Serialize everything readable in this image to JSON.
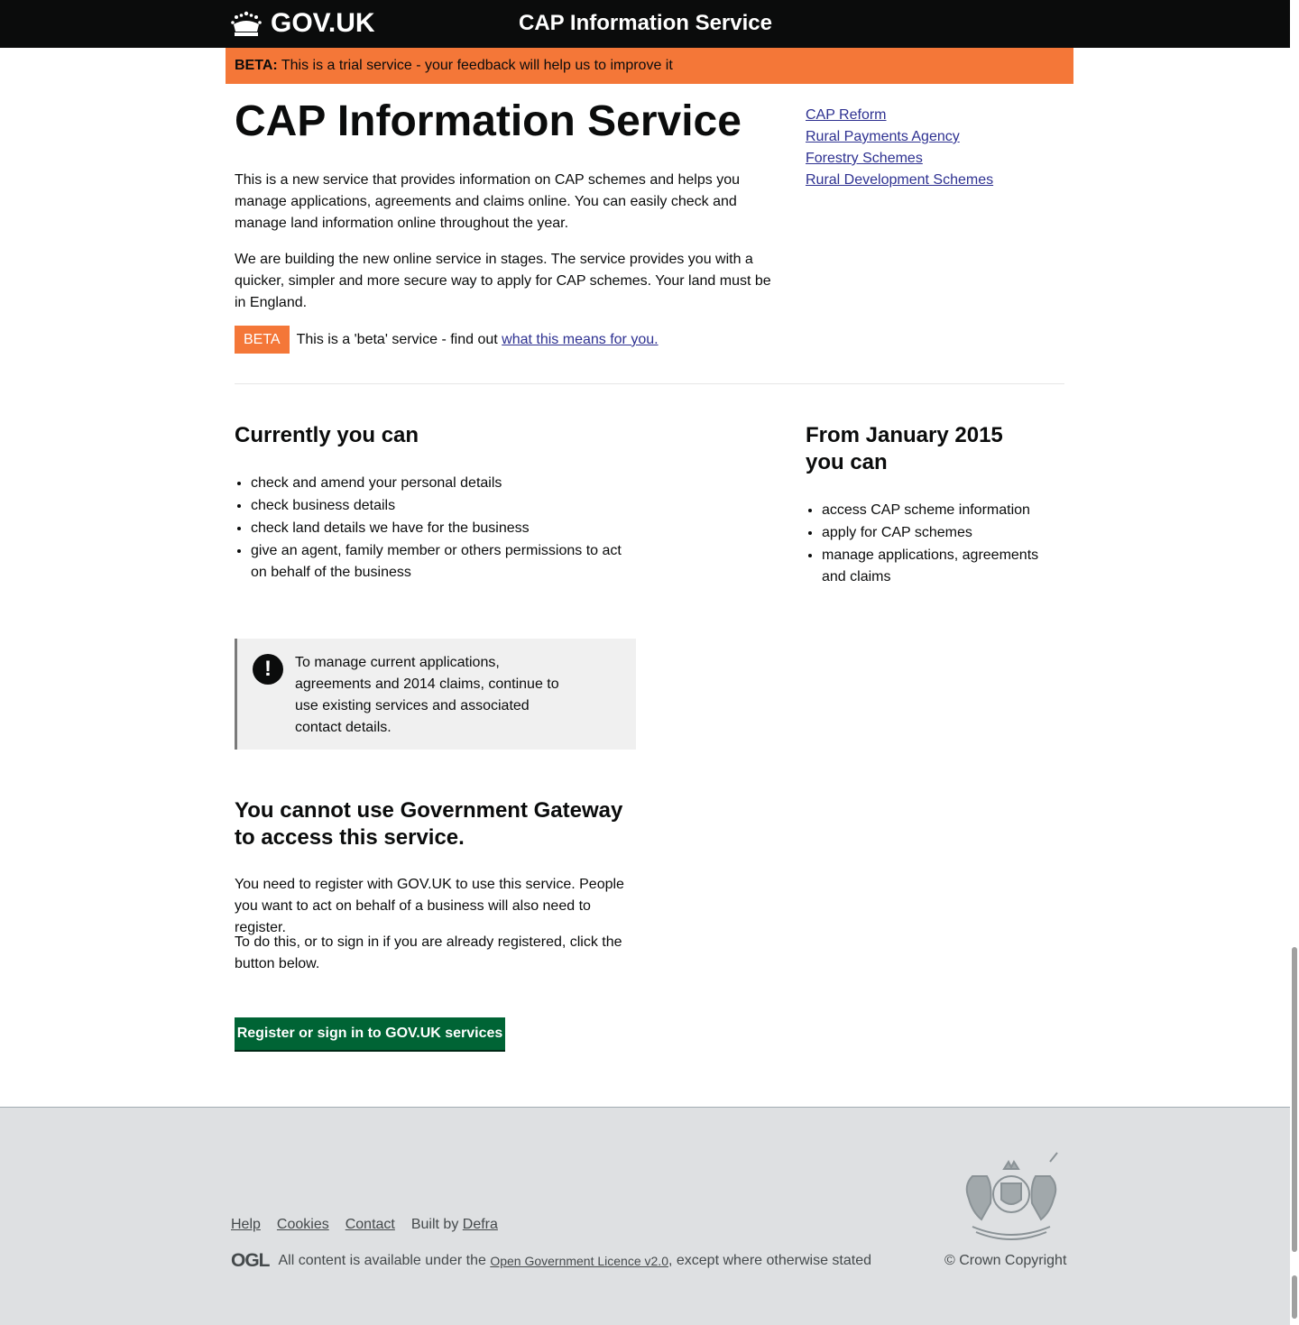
{
  "header": {
    "logo_text": "GOV.UK",
    "service_name": "CAP Information Service"
  },
  "beta_banner": {
    "label": "BETA:",
    "text": "This is a trial service - your feedback will help us to improve it"
  },
  "main": {
    "title": "CAP Information Service",
    "intro_1": "This is a new service that provides information on CAP schemes and helps you manage applications, agreements and claims online. You can easily check and manage land information online throughout the year.",
    "intro_2": "We are building the new online service in stages. The service provides you with a quicker, simpler and more secure way to apply for CAP schemes. Your land must be in England.",
    "beta_tag": "BETA",
    "beta_text": "This is a 'beta' service - find out ",
    "beta_link": "what this means for you."
  },
  "related_links": [
    "CAP Reform",
    "Rural Payments Agency",
    "Forestry Schemes",
    "Rural Development Schemes"
  ],
  "currently": {
    "heading": "Currently you can",
    "items": [
      "check and amend your personal details",
      "check business details",
      "check land details we have for the business",
      "give an agent, family member or others permissions to act on behalf of the business"
    ]
  },
  "future": {
    "heading": "From January 2015 you can",
    "items": [
      "access CAP scheme information",
      "apply for CAP schemes",
      "manage applications, agreements and claims"
    ]
  },
  "notice": {
    "icon": "!",
    "text": "To manage current applications, agreements and 2014 claims, continue to use existing services and associated contact details."
  },
  "gateway": {
    "heading": "You cannot use Government Gateway to access this service.",
    "para_1": "You need to register with GOV.UK to use this service. People you want to act on behalf of a business will also need to register.",
    "para_2": "To do this, or to sign in if you are already registered, click the button below.",
    "button": "Register or sign in to GOV.UK services"
  },
  "footer": {
    "help": "Help",
    "cookies": "Cookies",
    "contact": "Contact",
    "built_by": "Built by ",
    "defra": "Defra",
    "ogl_logo": "OGL",
    "licence_pre": "All content is available under the ",
    "licence_link": "Open Government Licence v2.0",
    "licence_post": ", except where otherwise stated",
    "copyright": "© Crown Copyright"
  },
  "colors": {
    "header_bg": "#0b0c0c",
    "beta_orange": "#f47738",
    "link": "#2e3191",
    "button_green": "#006435",
    "footer_bg": "#dee0e2"
  }
}
